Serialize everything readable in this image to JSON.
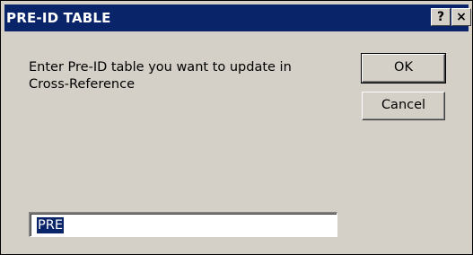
{
  "dialog": {
    "title": "PRE-ID TABLE",
    "help_label": "?",
    "close_label": "×",
    "prompt": "Enter Pre-ID table you want to update in\nCross-Reference",
    "ok_label": "OK",
    "cancel_label": "Cancel",
    "input_value": "PRE"
  },
  "colors": {
    "titlebar": "#0a246a",
    "face": "#d4d0c8",
    "selection": "#0a246a"
  }
}
